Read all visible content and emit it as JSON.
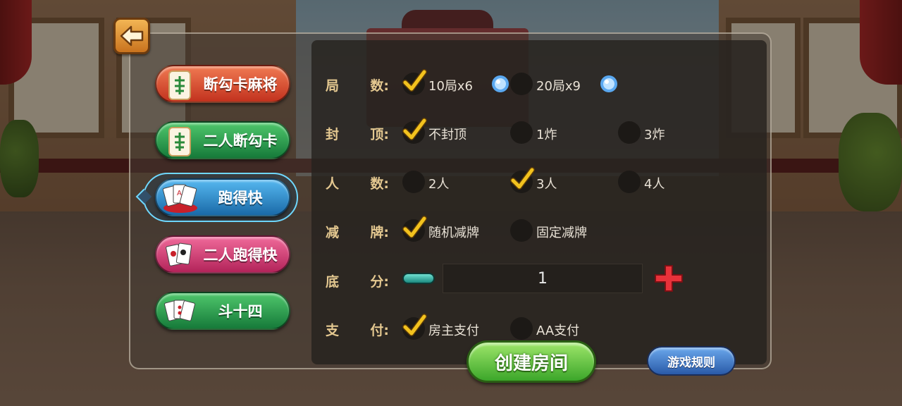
{
  "tabs": [
    {
      "label": "断勾卡麻将",
      "icon": "mahjong-tile-icon",
      "color": "red"
    },
    {
      "label": "二人断勾卡",
      "icon": "mahjong-tile-icon",
      "color": "green"
    },
    {
      "label": "跑得快",
      "icon": "playing-cards-icon",
      "color": "blue",
      "selected": true
    },
    {
      "label": "二人跑得快",
      "icon": "playing-cards-icon",
      "color": "pink"
    },
    {
      "label": "斗十四",
      "icon": "playing-cards-icon",
      "color": "green"
    }
  ],
  "options": {
    "rounds": {
      "label_a": "局",
      "label_b": "数:",
      "choices": [
        {
          "text": "10局x6",
          "checked": true
        },
        {
          "text": "20局x9",
          "checked": false
        }
      ]
    },
    "cap": {
      "label_a": "封",
      "label_b": "顶:",
      "choices": [
        {
          "text": "不封顶",
          "checked": true
        },
        {
          "text": "1炸",
          "checked": false
        },
        {
          "text": "3炸",
          "checked": false
        }
      ]
    },
    "players": {
      "label_a": "人",
      "label_b": "数:",
      "choices": [
        {
          "text": "2人",
          "checked": false
        },
        {
          "text": "3人",
          "checked": true
        },
        {
          "text": "4人",
          "checked": false
        }
      ]
    },
    "reduce": {
      "label_a": "减",
      "label_b": "牌:",
      "choices": [
        {
          "text": "随机减牌",
          "checked": true
        },
        {
          "text": "固定减牌",
          "checked": false
        }
      ]
    },
    "base_score": {
      "label_a": "底",
      "label_b": "分:",
      "value": "1"
    },
    "payment": {
      "label_a": "支",
      "label_b": "付:",
      "choices": [
        {
          "text": "房主支付",
          "checked": true
        },
        {
          "text": "AA支付",
          "checked": false
        }
      ]
    }
  },
  "buttons": {
    "create": "创建房间",
    "rules": "游戏规则"
  },
  "colors": {
    "label_gold": "#e4c890",
    "check_yellow": "#f2c21e",
    "selected_ring": "#6fd8ff"
  }
}
